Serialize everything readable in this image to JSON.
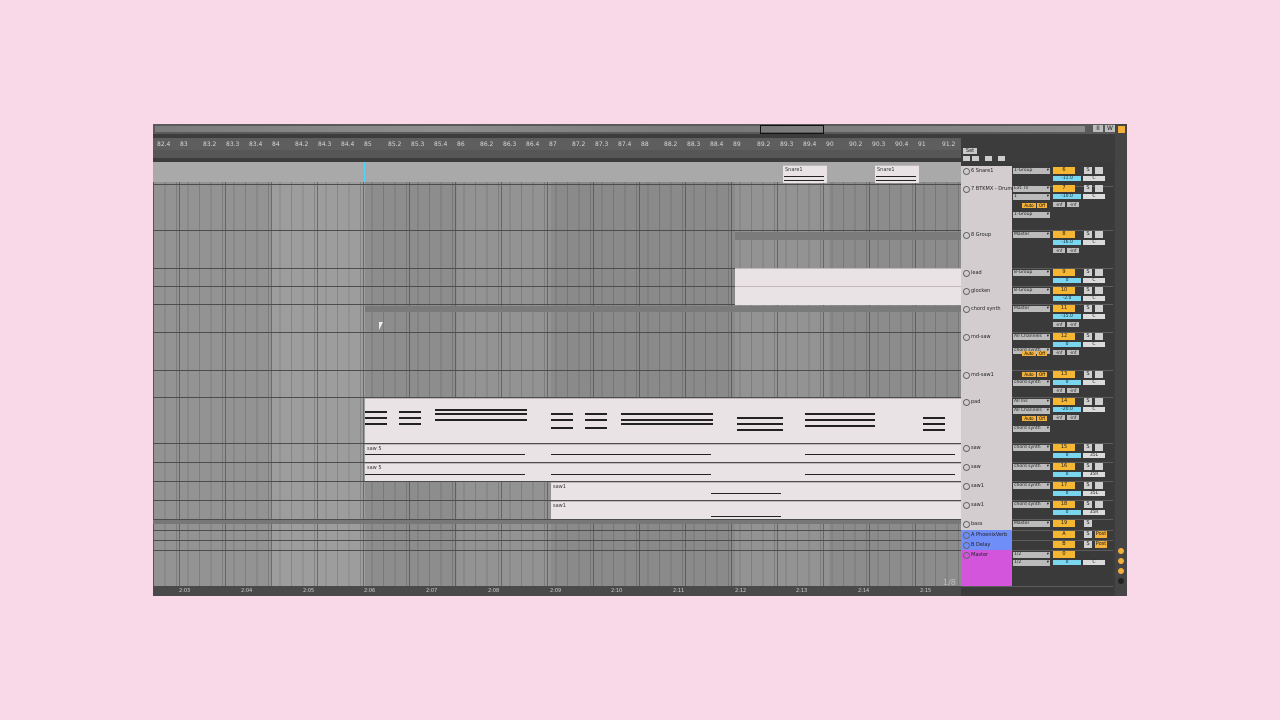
{
  "ruler_labels": [
    "82.4",
    "83",
    "83.2",
    "83.3",
    "83.4",
    "84",
    "84.2",
    "84.3",
    "84.4",
    "85",
    "85.2",
    "85.3",
    "85.4",
    "86",
    "86.2",
    "86.3",
    "86.4",
    "87",
    "87.2",
    "87.3",
    "87.4",
    "88",
    "88.2",
    "88.3",
    "88.4",
    "89",
    "89.2",
    "89.3",
    "89.4",
    "90",
    "90.2",
    "90.3",
    "90.4",
    "91",
    "91.2"
  ],
  "time_labels": [
    "2:03",
    "2:04",
    "2:05",
    "2:06",
    "2:07",
    "2:08",
    "2:09",
    "2:10",
    "2:11",
    "2:12",
    "2:13",
    "2:14",
    "2:15"
  ],
  "page_indicator": "1/8",
  "set_label": "Set",
  "overview_buttons": [
    "II",
    "W"
  ],
  "clip_names": {
    "snare1_a": "Snare1",
    "snare1_b": "Snare1",
    "saw5_a": "saw 5",
    "saw5_b": "saw 5",
    "saw1_a": "saw1",
    "saw1_b": "saw1"
  },
  "tracks": [
    {
      "name": "6 Snare1",
      "io": [
        "1-Group"
      ],
      "num": "6",
      "solo": "S",
      "vol": "-11.0",
      "pan": "C"
    },
    {
      "name": "7 BTKMX - Drums",
      "io": [
        "Ext. In",
        "1",
        "1-Group"
      ],
      "num": "7",
      "solo": "S",
      "vol": "-10.0",
      "pan": "C",
      "auto": "Auto",
      "off": "Off",
      "inf": [
        "-inf",
        "-inf"
      ]
    },
    {
      "name": "8 Group",
      "io": [
        "Master"
      ],
      "num": "8",
      "solo": "S",
      "vol": "-16.0",
      "pan": "C",
      "inf": [
        "-inf",
        "-inf"
      ]
    },
    {
      "name": "lead",
      "io": [
        "8-Group"
      ],
      "num": "9",
      "solo": "S",
      "vol": "0",
      "pan": "C"
    },
    {
      "name": "glocken",
      "io": [
        "8-Group"
      ],
      "num": "10",
      "solo": "S",
      "vol": "-2.0",
      "pan": "C"
    },
    {
      "name": "chord synth",
      "io": [
        "Master"
      ],
      "num": "11",
      "solo": "S",
      "vol": "-15.0",
      "pan": "C",
      "inf": [
        "-inf",
        "-inf"
      ]
    },
    {
      "name": "md-saw",
      "io": [
        "All Channels",
        "chord synth"
      ],
      "num": "12",
      "solo": "S",
      "vol": "0",
      "pan": "C",
      "auto": "Auto",
      "off": "Off",
      "inf": [
        "-inf",
        "-inf"
      ]
    },
    {
      "name": "md-saw1",
      "io": [
        "chord synth"
      ],
      "num": "13",
      "solo": "S",
      "vol": "0",
      "pan": "C",
      "auto": "Auto",
      "off": "Off",
      "inf": [
        "-inf",
        "-inf"
      ]
    },
    {
      "name": "pad",
      "io": [
        "All Ins",
        "All Channels",
        "chord synth"
      ],
      "num": "14",
      "solo": "S",
      "vol": "-20.0",
      "pan": "C",
      "auto": "Auto",
      "off": "Off",
      "inf": [
        "-inf",
        "-inf"
      ]
    },
    {
      "name": "saw",
      "io": [
        "chord synth"
      ],
      "num": "15",
      "solo": "S",
      "vol": "0",
      "pan": "35L"
    },
    {
      "name": "saw",
      "io": [
        "chord synth"
      ],
      "num": "16",
      "solo": "S",
      "vol": "0",
      "pan": "35R"
    },
    {
      "name": "saw1",
      "io": [
        "chord synth"
      ],
      "num": "17",
      "solo": "S",
      "vol": "0",
      "pan": "35L"
    },
    {
      "name": "saw1",
      "io": [
        "chord synth"
      ],
      "num": "18",
      "solo": "S",
      "vol": "0",
      "pan": "35R"
    },
    {
      "name": "bass",
      "io": [
        "Master"
      ],
      "num": "19",
      "solo": "S"
    },
    {
      "name": "A PhoenixVerb",
      "io": [],
      "num": "A",
      "solo": "S",
      "post": "Post"
    },
    {
      "name": "B Delay",
      "io": [],
      "num": "B",
      "solo": "S",
      "post": "Post"
    },
    {
      "name": "Master",
      "io": [
        "1/2",
        "1/2"
      ],
      "num": "0",
      "vol": "0",
      "pan": "C"
    }
  ],
  "colors": {
    "page_bg": "#f9d8e8",
    "track_number": "#f5b731",
    "volume": "#7ad6ef",
    "return_track": "#6f8ef7",
    "master_track": "#d255dc",
    "playhead": "#4fd3ff"
  }
}
